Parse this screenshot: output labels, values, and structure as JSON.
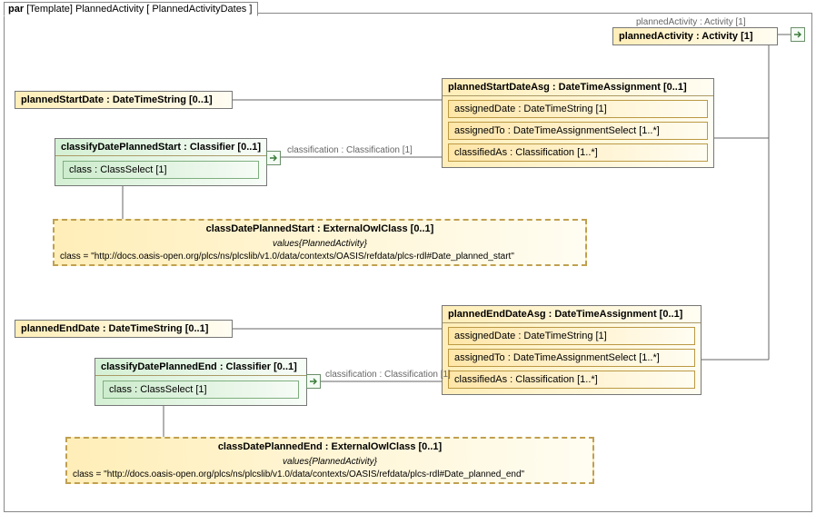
{
  "tab": {
    "label1": "par",
    "label2": "[Template] PlannedActivity [ PlannedActivityDates ]"
  },
  "plannedActivity": {
    "title": "plannedActivity : Activity [1]"
  },
  "plannedActivity_assoc": "plannedActivity : Activity [1]",
  "plannedStartDate": {
    "title": "plannedStartDate : DateTimeString [0..1]"
  },
  "plannedStartDateAsg": {
    "title": "plannedStartDateAsg : DateTimeAssignment [0..1]",
    "r1": "assignedDate : DateTimeString [1]",
    "r2": "assignedTo : DateTimeAssignmentSelect [1..*]",
    "r3": "classifiedAs : Classification [1..*]"
  },
  "classifyDatePlannedStart": {
    "title": "classifyDatePlannedStart : Classifier [0..1]",
    "row": "class : ClassSelect [1]"
  },
  "classification1": "classification : Classification [1]",
  "classDatePlannedStart": {
    "title": "classDatePlannedStart : ExternalOwlClass [0..1]",
    "caption": "values{PlannedActivity}",
    "row": "class = \"http://docs.oasis-open.org/plcs/ns/plcslib/v1.0/data/contexts/OASIS/refdata/plcs-rdl#Date_planned_start\""
  },
  "plannedEndDate": {
    "title": "plannedEndDate : DateTimeString [0..1]"
  },
  "plannedEndDateAsg": {
    "title": "plannedEndDateAsg : DateTimeAssignment [0..1]",
    "r1": "assignedDate : DateTimeString [1]",
    "r2": "assignedTo : DateTimeAssignmentSelect [1..*]",
    "r3": "classifiedAs : Classification [1..*]"
  },
  "classifyDatePlannedEnd": {
    "title": "classifyDatePlannedEnd : Classifier [0..1]",
    "row": "class : ClassSelect [1]"
  },
  "classification2": "classification : Classification [1]",
  "classDatePlannedEnd": {
    "title": "classDatePlannedEnd : ExternalOwlClass [0..1]",
    "caption": "values{PlannedActivity}",
    "row": "class = \"http://docs.oasis-open.org/plcs/ns/plcslib/v1.0/data/contexts/OASIS/refdata/plcs-rdl#Date_planned_end\""
  }
}
